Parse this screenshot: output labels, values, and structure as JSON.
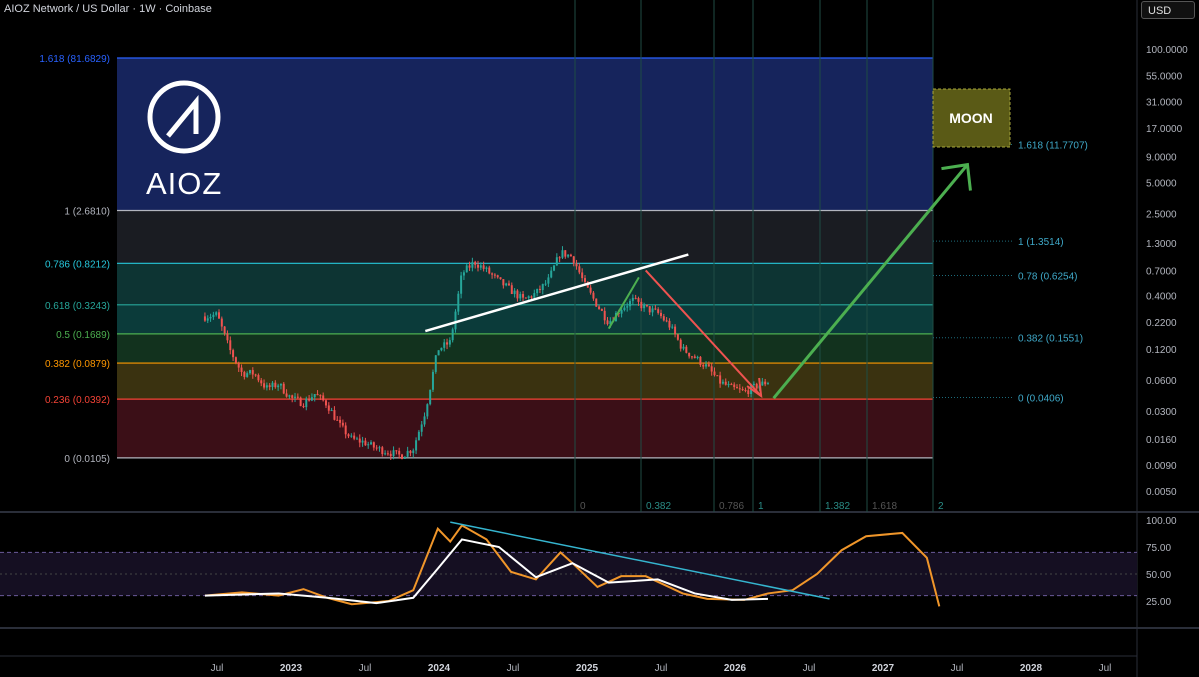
{
  "header": {
    "title": "AIOZ Network / US Dollar · 1W · Coinbase",
    "currency": "USD"
  },
  "logo": {
    "text": "AIOZ"
  },
  "colors": {
    "bg": "#000000",
    "blue_zone": "#16245c",
    "green_zone": "#0b3b3a",
    "teal_zone": "#0d3433",
    "amber_zone": "#3a3210",
    "red_zone": "#3b0f17",
    "up_candle": "#26a69a",
    "down_candle": "#ef5350",
    "rsi": "#f0962a",
    "rsi_ma": "#ffffff",
    "trendline": "#35b5cf",
    "arrow_green": "#4caf50",
    "arrow_red": "#ef5350"
  },
  "chart_data": [
    {
      "type": "candlestick",
      "title": "AIOZ Network / US Dollar · 1W · Coinbase",
      "y_scale": "log",
      "y_ticks": [
        "100.0000",
        "55.0000",
        "31.0000",
        "17.0000",
        "9.0000",
        "5.0000",
        "2.5000",
        "1.3000",
        "0.7000",
        "0.4000",
        "0.2200",
        "0.1200",
        "0.0600",
        "0.0300",
        "0.0160",
        "0.0090",
        "0.0050"
      ],
      "x_ticks": [
        "Jul",
        "2023",
        "Jul",
        "2024",
        "Jul",
        "2025",
        "Jul",
        "2026",
        "Jul",
        "2027",
        "Jul",
        "2028",
        "Jul"
      ],
      "price_path": [
        {
          "date": "2022-06",
          "price": 0.25
        },
        {
          "date": "2022-07",
          "price": 0.26
        },
        {
          "date": "2022-08",
          "price": 0.12
        },
        {
          "date": "2022-09",
          "price": 0.07
        },
        {
          "date": "2022-10",
          "price": 0.07
        },
        {
          "date": "2022-11",
          "price": 0.05
        },
        {
          "date": "2022-12",
          "price": 0.055
        },
        {
          "date": "2023-01",
          "price": 0.04
        },
        {
          "date": "2023-02",
          "price": 0.036
        },
        {
          "date": "2023-03",
          "price": 0.044
        },
        {
          "date": "2023-04",
          "price": 0.035
        },
        {
          "date": "2023-05",
          "price": 0.022
        },
        {
          "date": "2023-06",
          "price": 0.016
        },
        {
          "date": "2023-07",
          "price": 0.015
        },
        {
          "date": "2023-08",
          "price": 0.013
        },
        {
          "date": "2023-09",
          "price": 0.012
        },
        {
          "date": "2023-10",
          "price": 0.011
        },
        {
          "date": "2023-11",
          "price": 0.013
        },
        {
          "date": "2023-12",
          "price": 0.03
        },
        {
          "date": "2024-01",
          "price": 0.12
        },
        {
          "date": "2024-02",
          "price": 0.14
        },
        {
          "date": "2024-03",
          "price": 0.65
        },
        {
          "date": "2024-04",
          "price": 0.85
        },
        {
          "date": "2024-05",
          "price": 0.7
        },
        {
          "date": "2024-06",
          "price": 0.55
        },
        {
          "date": "2024-07",
          "price": 0.45
        },
        {
          "date": "2024-08",
          "price": 0.36
        },
        {
          "date": "2024-09",
          "price": 0.42
        },
        {
          "date": "2024-10",
          "price": 0.55
        },
        {
          "date": "2024-11",
          "price": 1.05
        },
        {
          "date": "2024-12",
          "price": 0.95
        },
        {
          "date": "2025-01",
          "price": 0.5
        },
        {
          "date": "2025-02",
          "price": 0.32
        },
        {
          "date": "2025-03",
          "price": 0.22
        },
        {
          "date": "2025-04",
          "price": 0.3
        },
        {
          "date": "2025-05",
          "price": 0.36
        },
        {
          "date": "2025-06",
          "price": 0.3
        },
        {
          "date": "2025-07",
          "price": 0.27
        },
        {
          "date": "2025-08",
          "price": 0.2
        },
        {
          "date": "2025-09",
          "price": 0.12
        },
        {
          "date": "2025-10",
          "price": 0.1
        },
        {
          "date": "2025-11",
          "price": 0.08
        },
        {
          "date": "2025-12",
          "price": 0.058
        },
        {
          "date": "2026-01",
          "price": 0.05
        },
        {
          "date": "2026-02",
          "price": 0.046
        },
        {
          "date": "2026-03",
          "price": 0.052
        },
        {
          "date": "2026-04",
          "price": 0.058
        }
      ],
      "fib_levels_left": [
        {
          "label": "1.618 (81.6829)",
          "color": "#2962ff"
        },
        {
          "label": "1 (2.6810)",
          "color": "#b2b5be"
        },
        {
          "label": "0.786 (0.8212)",
          "color": "#26c6da"
        },
        {
          "label": "0.618 (0.3243)",
          "color": "#26a69a"
        },
        {
          "label": "0.5 (0.1689)",
          "color": "#4caf50"
        },
        {
          "label": "0.382 (0.0879)",
          "color": "#ff9800"
        },
        {
          "label": "0.236 (0.0392)",
          "color": "#f44336"
        },
        {
          "label": "0 (0.0105)",
          "color": "#b2b5be"
        }
      ],
      "fib_levels_right": [
        {
          "label": "1.618 (11.7707)"
        },
        {
          "label": "1 (1.3514)"
        },
        {
          "label": "0.78 (0.6254)"
        },
        {
          "label": "0.382 (0.1551)"
        },
        {
          "label": "0 (0.0406)"
        }
      ],
      "time_fib_labels": [
        "0",
        "0.382",
        "0.786",
        "1",
        "1.382",
        "1.618",
        "2"
      ],
      "annotations": [
        "MOON"
      ]
    },
    {
      "type": "line",
      "title": "",
      "y_ticks": [
        "100.00",
        "75.00",
        "50.00",
        "25.00"
      ],
      "ylim": [
        0,
        100
      ],
      "series": [
        {
          "values": [
            {
              "date": "2022-06",
              "value": 30
            },
            {
              "date": "2022-09",
              "value": 33
            },
            {
              "date": "2022-12",
              "value": 30
            },
            {
              "date": "2023-02",
              "value": 36
            },
            {
              "date": "2023-04",
              "value": 28
            },
            {
              "date": "2023-06",
              "value": 22
            },
            {
              "date": "2023-09",
              "value": 25
            },
            {
              "date": "2023-11",
              "value": 35
            },
            {
              "date": "2024-01",
              "value": 92
            },
            {
              "date": "2024-02",
              "value": 80
            },
            {
              "date": "2024-03",
              "value": 95
            },
            {
              "date": "2024-05",
              "value": 82
            },
            {
              "date": "2024-07",
              "value": 52
            },
            {
              "date": "2024-09",
              "value": 45
            },
            {
              "date": "2024-11",
              "value": 70
            },
            {
              "date": "2024-12",
              "value": 60
            },
            {
              "date": "2025-02",
              "value": 38
            },
            {
              "date": "2025-04",
              "value": 48
            },
            {
              "date": "2025-06",
              "value": 48
            },
            {
              "date": "2025-09",
              "value": 32
            },
            {
              "date": "2025-11",
              "value": 27
            },
            {
              "date": "2026-02",
              "value": 26
            },
            {
              "date": "2026-04",
              "value": 32
            },
            {
              "date": "2026-06",
              "value": 35
            },
            {
              "date": "2026-08",
              "value": 50
            },
            {
              "date": "2026-10",
              "value": 72
            },
            {
              "date": "2026-12",
              "value": 85
            },
            {
              "date": "2027-03",
              "value": 88
            },
            {
              "date": "2027-05",
              "value": 65
            },
            {
              "date": "2027-06",
              "value": 20
            }
          ]
        },
        {
          "values": [
            {
              "date": "2022-06",
              "value": 30
            },
            {
              "date": "2022-12",
              "value": 32
            },
            {
              "date": "2023-04",
              "value": 28
            },
            {
              "date": "2023-08",
              "value": 23
            },
            {
              "date": "2023-11",
              "value": 28
            },
            {
              "date": "2024-01",
              "value": 55
            },
            {
              "date": "2024-03",
              "value": 82
            },
            {
              "date": "2024-06",
              "value": 75
            },
            {
              "date": "2024-09",
              "value": 47
            },
            {
              "date": "2024-12",
              "value": 60
            },
            {
              "date": "2025-03",
              "value": 42
            },
            {
              "date": "2025-07",
              "value": 45
            },
            {
              "date": "2025-10",
              "value": 32
            },
            {
              "date": "2026-01",
              "value": 26
            },
            {
              "date": "2026-04",
              "value": 27
            }
          ]
        }
      ]
    }
  ]
}
